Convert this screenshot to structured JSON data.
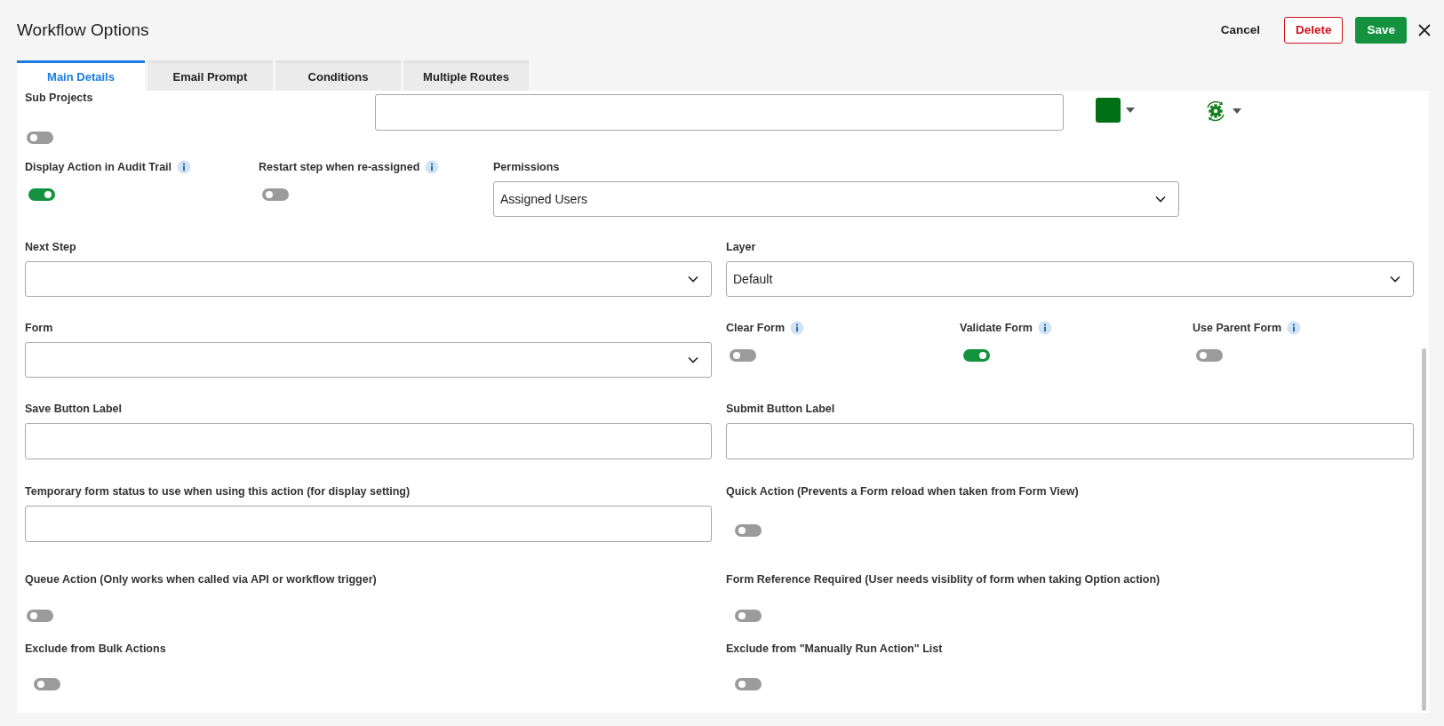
{
  "window": {
    "title": "Workflow Options"
  },
  "actions": [
    {
      "label": "Cancel",
      "kind": "plain"
    },
    {
      "label": "Delete",
      "kind": "danger"
    },
    {
      "label": "Save",
      "kind": "primary"
    }
  ],
  "tabs": [
    {
      "label": "Main Details",
      "selected": true
    },
    {
      "label": "Email Prompt",
      "selected": false
    },
    {
      "label": "Conditions",
      "selected": false
    },
    {
      "label": "Multiple Routes",
      "selected": false
    }
  ],
  "rows": [
    {
      "items": [
        {
          "kind": "toggle",
          "label": "Sub Projects",
          "info": false,
          "on": false
        },
        {
          "kind": "text"
        },
        {
          "kind": "color",
          "color": "#007014"
        },
        {
          "kind": "icon-picker"
        }
      ]
    },
    {
      "items": [
        {
          "kind": "toggle",
          "label": "Display Action in Audit Trail",
          "info": true,
          "on": true
        },
        {
          "kind": "toggle",
          "label": "Restart step when re-assigned",
          "info": true,
          "on": false
        },
        {
          "kind": "select",
          "label": "Permissions",
          "info": false,
          "value": "Assigned Users"
        }
      ]
    },
    {
      "items": [
        {
          "kind": "select",
          "label": "Next Step",
          "info": false
        },
        {
          "kind": "select",
          "label": "Layer",
          "info": false,
          "value": "Default"
        }
      ]
    },
    {
      "items": [
        {
          "kind": "select",
          "label": "Form",
          "info": false
        },
        {
          "kind": "toggle",
          "label": "Clear Form",
          "info": true,
          "on": false
        },
        {
          "kind": "toggle",
          "label": "Validate Form",
          "info": true,
          "on": true
        },
        {
          "kind": "toggle",
          "label": "Use Parent Form",
          "info": true,
          "on": false
        }
      ]
    },
    {
      "items": [
        {
          "kind": "text",
          "label": "Save Button Label",
          "info": false
        },
        {
          "kind": "text",
          "label": "Submit Button Label",
          "info": false
        }
      ]
    },
    {
      "items": [
        {
          "kind": "text",
          "label": "Temporary form status to use when using this action (for display setting)",
          "info": false
        },
        {
          "kind": "toggle",
          "label": "Quick Action (Prevents a Form reload when taken from Form View)",
          "info": false,
          "on": false
        }
      ]
    },
    {
      "items": [
        {
          "kind": "toggle",
          "label": "Queue Action (Only works when called via API or workflow trigger)",
          "info": false,
          "on": false
        },
        {
          "kind": "toggle",
          "label": "Form Reference Required (User needs visiblity of form when taking Option action)",
          "info": false,
          "on": false
        }
      ]
    },
    {
      "items": [
        {
          "kind": "toggle",
          "label": "Exclude from Bulk Actions",
          "info": false,
          "on": false
        },
        {
          "kind": "toggle",
          "label": "Exclude from \"Manually Run Action\" List",
          "info": false,
          "on": false
        }
      ]
    }
  ]
}
